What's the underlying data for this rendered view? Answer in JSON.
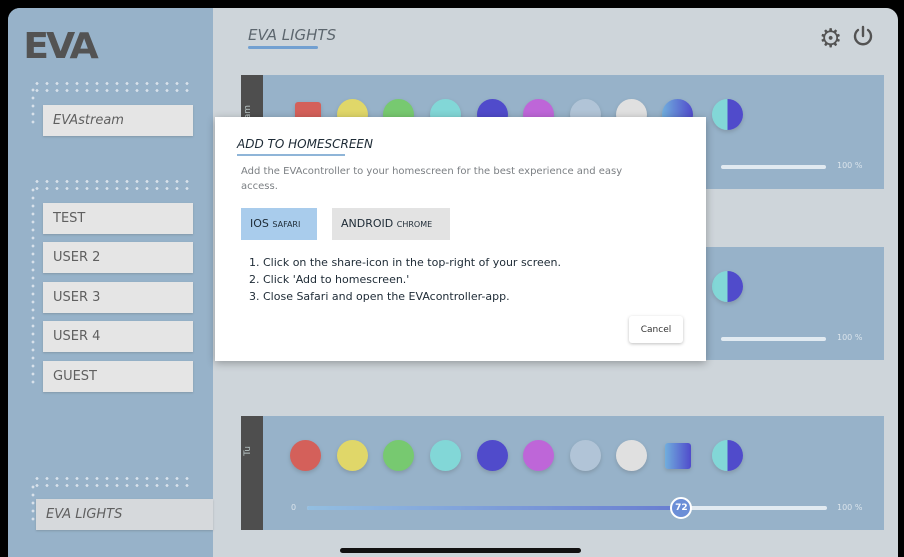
{
  "app": {
    "logo": "EVA"
  },
  "sidebar": {
    "stream": "EVAstream",
    "users": [
      "TEST",
      "USER 2",
      "USER 3",
      "USER 4",
      "GUEST"
    ],
    "active": "EVA LIGHTS"
  },
  "header": {
    "title": "EVA LIGHTS"
  },
  "panels": [
    {
      "tab": "am",
      "slider_start": "",
      "slider_end": "100 %"
    },
    {
      "tab": "",
      "slider_start": "",
      "slider_end": "100 %"
    },
    {
      "tab": "Tu",
      "slider_start": "0",
      "slider_end": "100 %",
      "value": 72
    }
  ],
  "colors": {
    "swatches": [
      "#c4231b",
      "#d4c830",
      "#43b53a",
      "#53c8c8",
      "#0d06b8",
      "#a52cc9",
      "#93aec8",
      "#d4d4d4"
    ],
    "accent": "#3363c8"
  },
  "modal": {
    "title": "ADD TO HOMESCREEN",
    "description": "Add the EVAcontroller to your homescreen for the best experience and easy access.",
    "tab_ios_main": "IOS",
    "tab_ios_small": "SAFARI",
    "tab_android_main": "ANDROID",
    "tab_android_small": "CHROME",
    "steps": [
      "1.  Click on the share-icon in the top-right of your screen.",
      "2.  Click 'Add to homescreen.'",
      "3.  Close Safari and open the EVAcontroller-app."
    ],
    "cancel": "Cancel"
  }
}
